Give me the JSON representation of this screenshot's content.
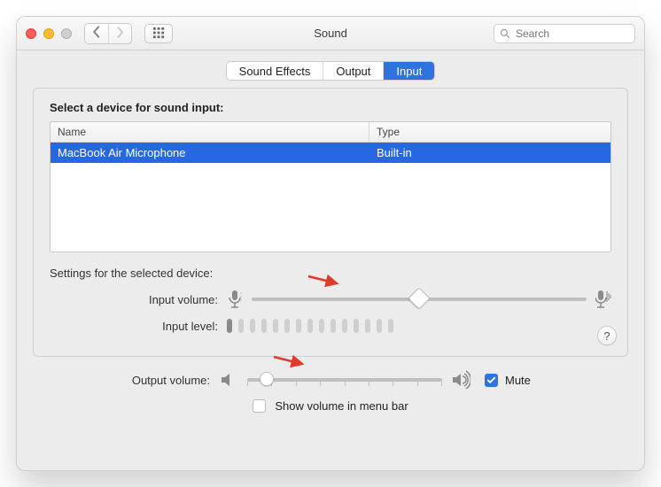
{
  "window": {
    "title": "Sound"
  },
  "search": {
    "placeholder": "Search"
  },
  "tabs": [
    {
      "label": "Sound Effects",
      "active": false
    },
    {
      "label": "Output",
      "active": false
    },
    {
      "label": "Input",
      "active": true
    }
  ],
  "panel": {
    "heading": "Select a device for sound input:",
    "columns": {
      "name": "Name",
      "type": "Type"
    },
    "rows": [
      {
        "name": "MacBook Air Microphone",
        "type": "Built-in",
        "selected": true
      }
    ],
    "settings_heading": "Settings for the selected device:",
    "input_volume_label": "Input volume:",
    "input_volume_percent": 50,
    "input_level_label": "Input level:",
    "input_level_active_bars": 1,
    "input_level_total_bars": 15
  },
  "footer": {
    "output_volume_label": "Output volume:",
    "output_volume_percent": 10,
    "mute_label": "Mute",
    "mute_checked": true,
    "menubar_label": "Show volume in menu bar",
    "menubar_checked": false
  },
  "help_label": "?"
}
